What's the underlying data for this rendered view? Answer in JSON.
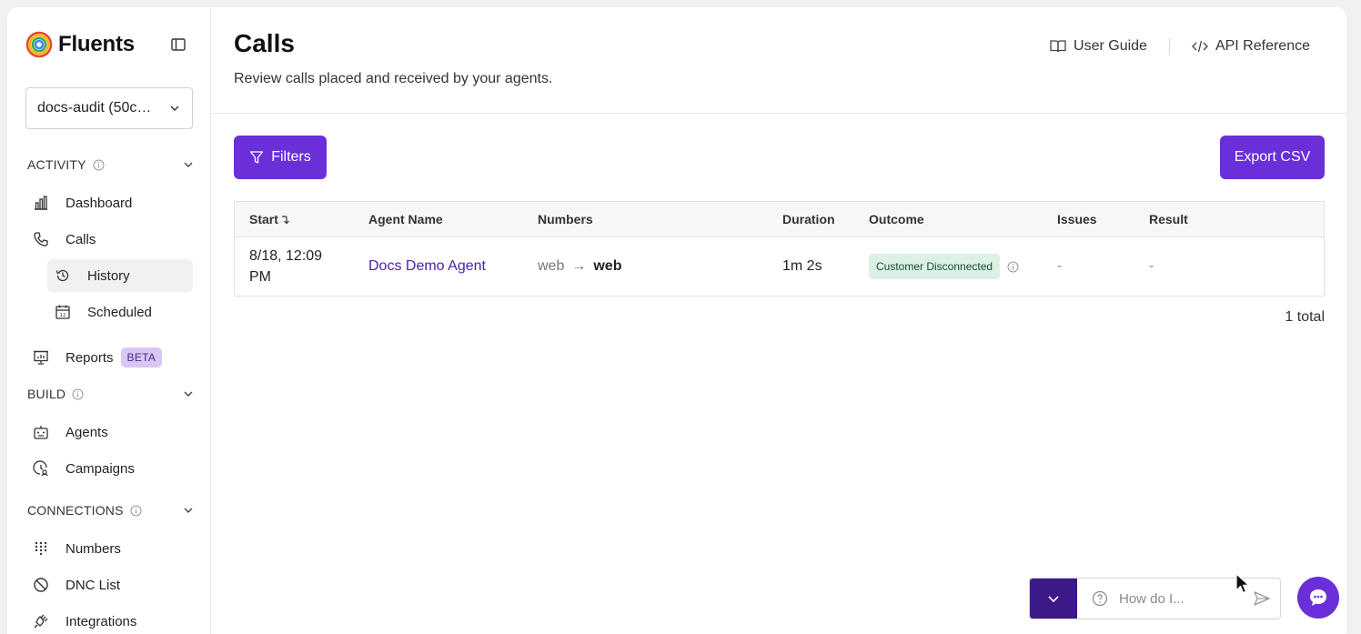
{
  "app": {
    "name": "Fluents"
  },
  "workspace": {
    "selected": "docs-audit (50c…"
  },
  "sidebar": {
    "sections": [
      {
        "label": "ACTIVITY"
      },
      {
        "label": "BUILD"
      },
      {
        "label": "CONNECTIONS"
      }
    ],
    "items": [
      {
        "label": "Dashboard",
        "icon": "bar-chart-icon"
      },
      {
        "label": "Calls",
        "icon": "phone-icon"
      },
      {
        "label": "History",
        "icon": "history-icon",
        "active": true
      },
      {
        "label": "Scheduled",
        "icon": "calendar-icon"
      },
      {
        "label": "Reports",
        "icon": "presentation-icon",
        "badge": "BETA"
      },
      {
        "label": "Agents",
        "icon": "robot-icon"
      },
      {
        "label": "Campaigns",
        "icon": "campaign-icon"
      },
      {
        "label": "Numbers",
        "icon": "dialpad-icon"
      },
      {
        "label": "DNC List",
        "icon": "ban-icon"
      },
      {
        "label": "Integrations",
        "icon": "plug-icon"
      }
    ]
  },
  "header": {
    "title": "Calls",
    "subtitle": "Review calls placed and received by your agents.",
    "links": {
      "user_guide": "User Guide",
      "api_reference": "API Reference"
    }
  },
  "toolbar": {
    "filters_label": "Filters",
    "export_label": "Export CSV"
  },
  "table": {
    "columns": {
      "start": "Start",
      "agent_name": "Agent Name",
      "numbers": "Numbers",
      "duration": "Duration",
      "outcome": "Outcome",
      "issues": "Issues",
      "result": "Result"
    },
    "rows": [
      {
        "start_line1": "8/18, 12:09",
        "start_line2": "PM",
        "agent_name": "Docs Demo Agent",
        "number_from": "web",
        "number_arrow": "→",
        "number_to": "web",
        "duration": "1m 2s",
        "outcome": "Customer Disconnected",
        "issues": "-",
        "result": "-"
      }
    ],
    "total": "1 total"
  },
  "chat": {
    "placeholder": "How do I..."
  },
  "colors": {
    "primary": "#6a2fd8",
    "chat_toggle": "#3d1a8a",
    "badge_beta_bg": "#d8c6f3",
    "outcome_bg": "#daf1e4"
  }
}
